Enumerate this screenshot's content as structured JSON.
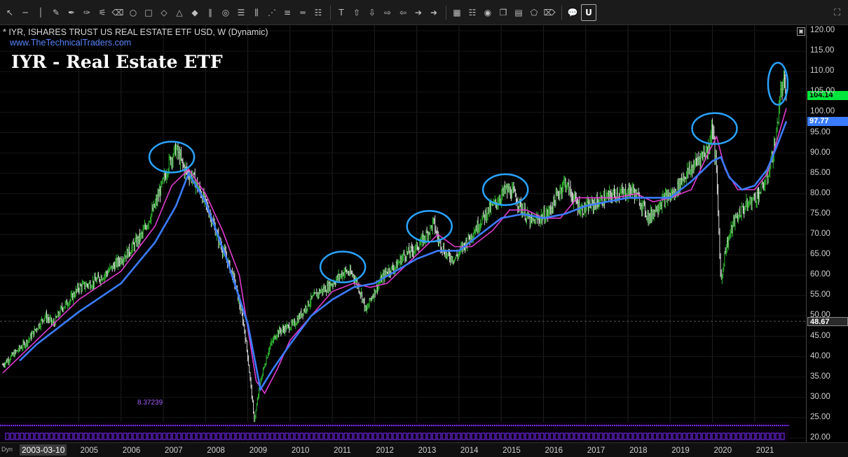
{
  "toolbar": {
    "icons": [
      "select-arrow-icon",
      "horizontal-line-icon",
      "vertical-line-icon",
      "pencil-icon",
      "pen-icon",
      "brush-icon",
      "paint-icon",
      "eraser-icon",
      "ellipse-icon",
      "rectangle-icon",
      "diamond-icon",
      "triangle-icon",
      "marker-icon",
      "parallel-lines-icon",
      "fibonacci-icon",
      "gann-icon",
      "bars-icon",
      "zigzag-icon",
      "list-icon",
      "equal-icon",
      "rows-icon",
      "text-icon",
      "arrow-up-icon",
      "arrow-down-icon",
      "arrow-right-icon",
      "arrow-left-icon",
      "arrow-right2-icon",
      "arrow-left2-icon",
      "grid-icon",
      "lines-icon",
      "eye-icon",
      "clone-icon",
      "image-icon",
      "shape-icon",
      "eraser2-icon",
      "comment-icon",
      "magnet-icon"
    ]
  },
  "header": {
    "symbol_description": "* IYR, ISHARES TRUST US REAL ESTATE ETF USD, W (Dynamic)",
    "website": "www.TheTechnicalTraders.com",
    "overlay_title": "IYR - Real Estate ETF"
  },
  "price_tags": {
    "last_price": "104.14",
    "ma_value": "97.77",
    "crosshair_value": "48.67"
  },
  "indicator_value": "8.37239",
  "start_date": "2003-03-10",
  "dyn_label": "Dyn",
  "colors": {
    "up_candle": "#2eb82e",
    "down_candle": "#d9d9d9",
    "ma_fast": "#e23bd0",
    "ma_slow": "#3b7cff",
    "highlight_circles": "#29a3ff",
    "indicator": "#7a2cff",
    "last_price_tag": "#00e63b",
    "ma_tag": "#3b7cff"
  },
  "chart_data": {
    "type": "line",
    "title": "IYR - Real Estate ETF",
    "xlabel": "",
    "ylabel": "",
    "ylim": [
      20,
      120
    ],
    "xlim": [
      2003.2,
      2021.75
    ],
    "y_ticks": [
      "120.00",
      "115.00",
      "110.00",
      "105.00",
      "100.00",
      "95.00",
      "90.00",
      "85.00",
      "80.00",
      "75.00",
      "70.00",
      "65.00",
      "60.00",
      "55.00",
      "50.00",
      "45.00",
      "40.00",
      "35.00",
      "30.00",
      "25.00",
      "20.00"
    ],
    "x_ticks": [
      "2005",
      "2006",
      "2007",
      "2008",
      "2009",
      "2010",
      "2011",
      "2012",
      "2013",
      "2014",
      "2015",
      "2016",
      "2017",
      "2018",
      "2019",
      "2020",
      "2021"
    ],
    "series": [
      {
        "kind": "price",
        "x": [
          2003.2,
          2003.5,
          2003.8,
          2004.0,
          2004.2,
          2004.4,
          2004.6,
          2004.8,
          2005.0,
          2005.3,
          2005.6,
          2005.9,
          2006.2,
          2006.5,
          2006.8,
          2007.0,
          2007.15,
          2007.3,
          2007.5,
          2007.7,
          2007.9,
          2008.1,
          2008.3,
          2008.5,
          2008.7,
          2008.9,
          2009.0,
          2009.1,
          2009.15,
          2009.3,
          2009.5,
          2009.7,
          2009.9,
          2010.1,
          2010.3,
          2010.5,
          2010.7,
          2010.9,
          2011.1,
          2011.3,
          2011.5,
          2011.7,
          2011.8,
          2011.9,
          2012.1,
          2012.3,
          2012.5,
          2012.7,
          2012.9,
          2013.1,
          2013.3,
          2013.4,
          2013.5,
          2013.7,
          2013.9,
          2014.1,
          2014.3,
          2014.5,
          2014.7,
          2014.9,
          2015.1,
          2015.3,
          2015.5,
          2015.7,
          2015.9,
          2016.1,
          2016.3,
          2016.5,
          2016.7,
          2016.9,
          2017.1,
          2017.3,
          2017.5,
          2017.7,
          2017.9,
          2018.1,
          2018.3,
          2018.5,
          2018.7,
          2018.9,
          2019.1,
          2019.3,
          2019.5,
          2019.7,
          2019.9,
          2020.0,
          2020.1,
          2020.2,
          2020.3,
          2020.5,
          2020.7,
          2020.9,
          2021.1,
          2021.3,
          2021.5,
          2021.6,
          2021.7,
          2021.75
        ],
        "values": [
          38,
          41,
          44,
          47,
          50,
          48,
          52,
          54,
          57,
          58,
          60,
          63,
          66,
          70,
          77,
          83,
          88,
          91,
          86,
          84,
          80,
          75,
          69,
          64,
          58,
          48,
          40,
          30,
          24,
          34,
          42,
          46,
          47,
          48,
          51,
          54,
          56,
          57,
          59,
          61,
          60,
          55,
          51,
          54,
          58,
          61,
          62,
          65,
          66,
          68,
          71,
          73,
          69,
          65,
          64,
          67,
          70,
          73,
          76,
          78,
          81,
          80,
          76,
          73,
          74,
          75,
          79,
          83,
          79,
          76,
          77,
          78,
          79,
          80,
          80,
          81,
          78,
          74,
          77,
          79,
          80,
          84,
          86,
          89,
          91,
          97,
          85,
          58,
          66,
          73,
          76,
          78,
          80,
          84,
          93,
          104,
          107,
          104.14
        ]
      },
      {
        "name": "",
        "kind": "ma_fast",
        "x": [
          2003.2,
          2004.0,
          2005.0,
          2006.0,
          2006.8,
          2007.2,
          2007.6,
          2008.0,
          2008.4,
          2008.8,
          2009.0,
          2009.2,
          2009.4,
          2009.7,
          2010.0,
          2010.5,
          2011.0,
          2011.5,
          2011.9,
          2012.3,
          2012.8,
          2013.2,
          2013.5,
          2013.9,
          2014.3,
          2014.8,
          2015.2,
          2015.6,
          2016.0,
          2016.4,
          2016.8,
          2017.2,
          2017.7,
          2018.2,
          2018.6,
          2019.0,
          2019.5,
          2019.9,
          2020.1,
          2020.3,
          2020.6,
          2021.0,
          2021.3,
          2021.5,
          2021.75
        ],
        "values": [
          36,
          44,
          54,
          61,
          72,
          82,
          86,
          80,
          71,
          60,
          47,
          34,
          31,
          37,
          44,
          50,
          56,
          58,
          57,
          58,
          63,
          67,
          70,
          67,
          67,
          71,
          76,
          76,
          74,
          74,
          79,
          79,
          79,
          80,
          78,
          79,
          81,
          90,
          94,
          86,
          81,
          81,
          85,
          92,
          101
        ]
      },
      {
        "name": "",
        "kind": "ma_slow",
        "x": [
          2003.6,
          2004.0,
          2005.0,
          2006.0,
          2006.8,
          2007.3,
          2007.6,
          2008.0,
          2008.5,
          2009.0,
          2009.3,
          2009.6,
          2010.0,
          2010.5,
          2011.0,
          2011.5,
          2012.0,
          2012.5,
          2013.0,
          2013.5,
          2014.0,
          2014.5,
          2015.0,
          2015.5,
          2016.0,
          2016.5,
          2017.0,
          2017.5,
          2018.0,
          2018.5,
          2019.0,
          2019.5,
          2020.0,
          2020.2,
          2020.4,
          2020.7,
          2021.0,
          2021.3,
          2021.5,
          2021.75
        ],
        "values": [
          39,
          43,
          51,
          58,
          68,
          77,
          85,
          78,
          64,
          48,
          32,
          37,
          43,
          50,
          54,
          57,
          58,
          61,
          64,
          66,
          66,
          70,
          74,
          75,
          74,
          75,
          77,
          78,
          79,
          79,
          79,
          83,
          88,
          89,
          84,
          81,
          82,
          86,
          91,
          97.77
        ]
      }
    ],
    "annotations": [
      {
        "type": "circle",
        "x": 2007.2,
        "y": 89
      },
      {
        "type": "circle",
        "x": 2011.25,
        "y": 62
      },
      {
        "type": "circle",
        "x": 2013.3,
        "y": 72
      },
      {
        "type": "circle",
        "x": 2015.1,
        "y": 81
      },
      {
        "type": "circle",
        "x": 2020.05,
        "y": 96
      },
      {
        "type": "circle",
        "x": 2021.55,
        "y": 107
      }
    ]
  }
}
